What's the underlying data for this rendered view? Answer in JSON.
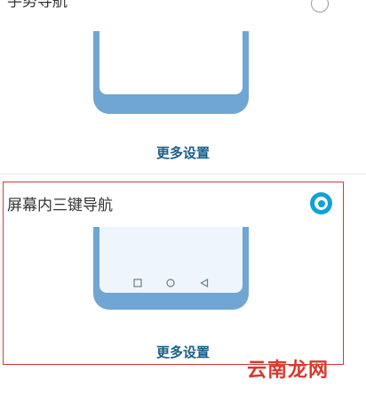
{
  "gesture": {
    "title": "手势导航",
    "more_settings": "更多设置"
  },
  "three_key": {
    "title": "屏幕内三键导航",
    "more_settings": "更多设置",
    "nav_keys": [
      "square-icon",
      "circle-icon",
      "triangle-icon"
    ]
  },
  "watermark": "云南龙网",
  "colors": {
    "phone": "#6fa6d3",
    "accent": "#12a1d8",
    "link": "#1a5f8a",
    "highlight_border": "#d23a3a",
    "watermark": "#d73a2f"
  }
}
